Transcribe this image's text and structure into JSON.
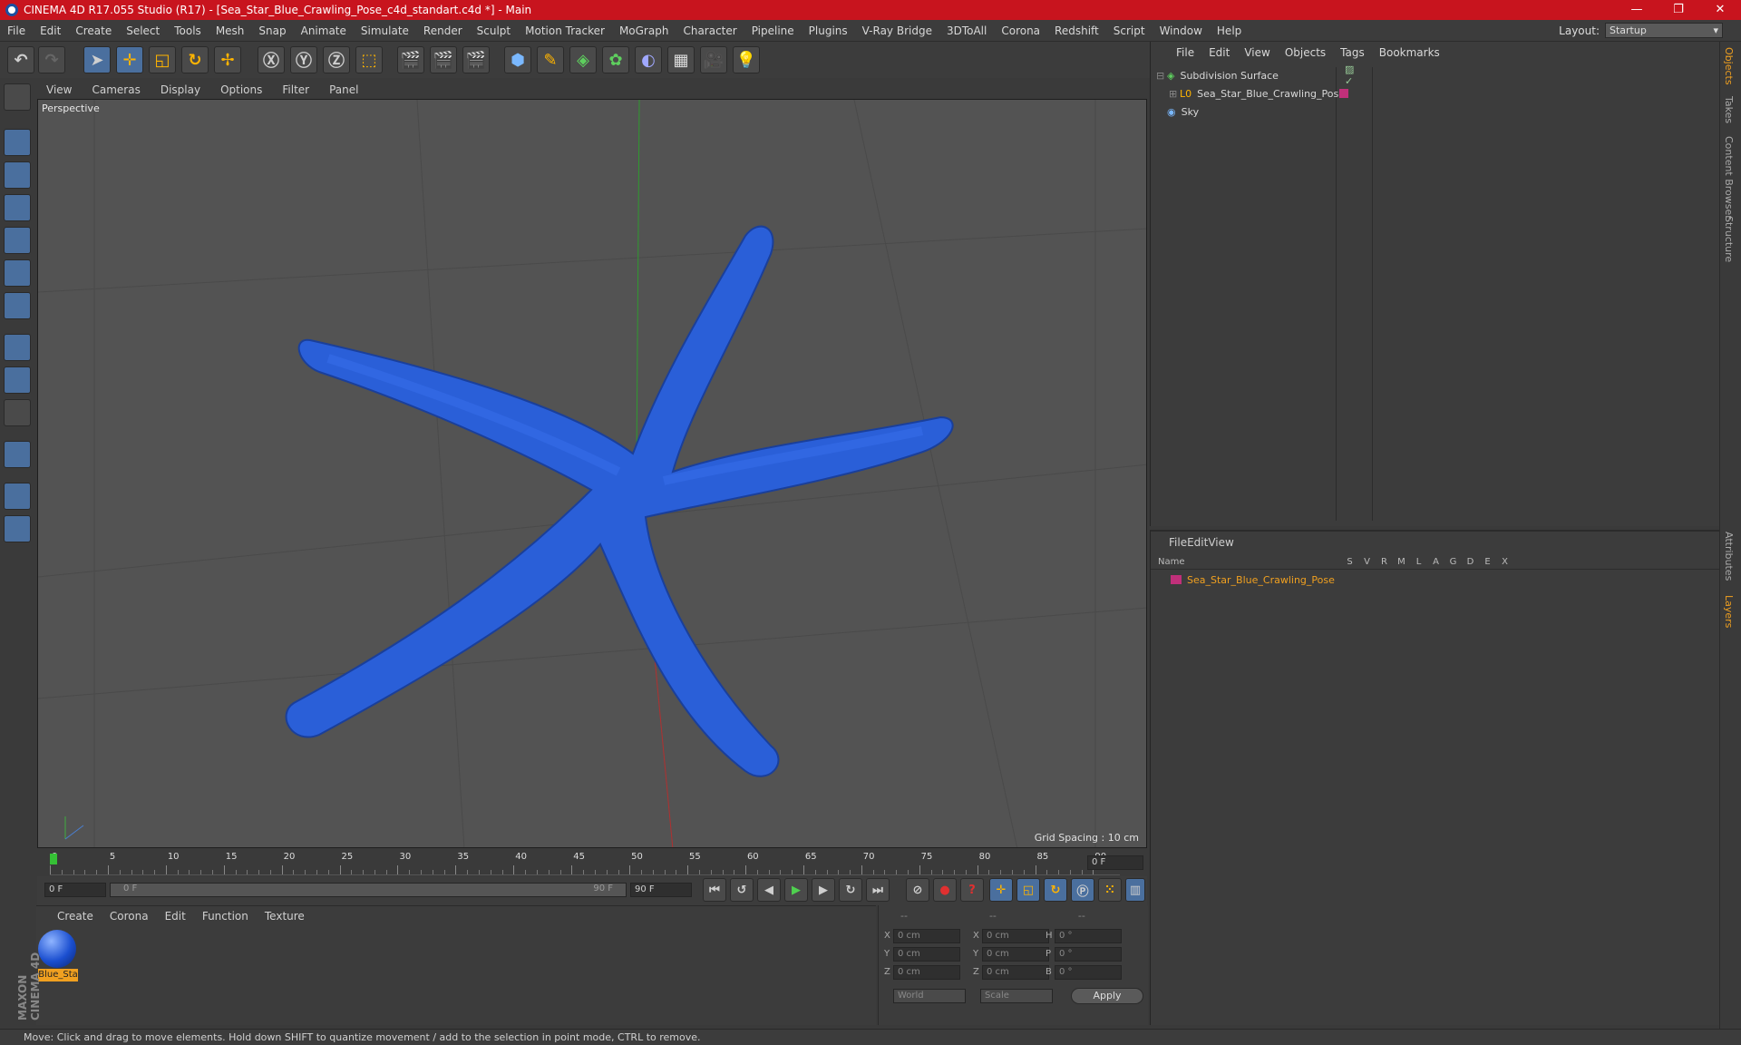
{
  "app": {
    "title": "CINEMA 4D R17.055 Studio (R17) - [Sea_Star_Blue_Crawling_Pose_c4d_standart.c4d *] - Main"
  },
  "menu": [
    "File",
    "Edit",
    "Create",
    "Select",
    "Tools",
    "Mesh",
    "Snap",
    "Animate",
    "Simulate",
    "Render",
    "Sculpt",
    "Motion Tracker",
    "MoGraph",
    "Character",
    "Pipeline",
    "Plugins",
    "V-Ray Bridge",
    "3DToAll",
    "Corona",
    "Redshift",
    "Script",
    "Window",
    "Help"
  ],
  "layout": {
    "label": "Layout:",
    "value": "Startup"
  },
  "viewport": {
    "menu": [
      "View",
      "Cameras",
      "Display",
      "Options",
      "Filter",
      "Panel"
    ],
    "label": "Perspective",
    "grid_spacing": "Grid Spacing : 10 cm"
  },
  "timeline": {
    "ticks": [
      "0",
      "5",
      "10",
      "15",
      "20",
      "25",
      "30",
      "35",
      "40",
      "45",
      "50",
      "55",
      "60",
      "65",
      "70",
      "75",
      "80",
      "85",
      "90"
    ],
    "current_frame": "0 F",
    "start": "0 F",
    "slider_start": "0 F",
    "slider_end": "90 F",
    "end": "90 F"
  },
  "objects_panel": {
    "menu": [
      "File",
      "Edit",
      "View",
      "Objects",
      "Tags",
      "Bookmarks"
    ],
    "rows": [
      {
        "name": "Subdivision Surface"
      },
      {
        "name": "Sea_Star_Blue_Crawling_Pose"
      },
      {
        "name": "Sky"
      }
    ]
  },
  "layers_panel": {
    "menu": [
      "File",
      "Edit",
      "View"
    ],
    "header_name": "Name",
    "columns": [
      "S",
      "V",
      "R",
      "M",
      "L",
      "A",
      "G",
      "D",
      "E",
      "X"
    ],
    "rows": [
      {
        "name": "Sea_Star_Blue_Crawling_Pose"
      }
    ]
  },
  "material_panel": {
    "menu": [
      "Create",
      "Corona",
      "Edit",
      "Function",
      "Texture"
    ],
    "materials": [
      {
        "name": "Blue_Sta"
      }
    ]
  },
  "coords_panel": {
    "headers": [
      "--",
      "--",
      "--"
    ],
    "rows": [
      {
        "a": "X",
        "av": "0 cm",
        "b": "X",
        "bv": "0 cm",
        "c": "H",
        "cv": "0 °"
      },
      {
        "a": "Y",
        "av": "0 cm",
        "b": "Y",
        "bv": "0 cm",
        "c": "P",
        "cv": "0 °"
      },
      {
        "a": "Z",
        "av": "0 cm",
        "b": "Z",
        "bv": "0 cm",
        "c": "B",
        "cv": "0 °"
      }
    ],
    "world": "World",
    "scale": "Scale",
    "apply": "Apply"
  },
  "side_tabs": [
    "Objects",
    "Takes",
    "Content Browser",
    "Structure",
    "Attributes",
    "Layers"
  ],
  "status": "Move: Click and drag to move elements. Hold down SHIFT to quantize movement / add to the selection in point mode, CTRL to remove.",
  "colors": {
    "title_bar": "#c8141e",
    "accent_blue": "#4a6f9e",
    "seastar": "#2a5fd8",
    "layer_name": "#f0a020"
  }
}
